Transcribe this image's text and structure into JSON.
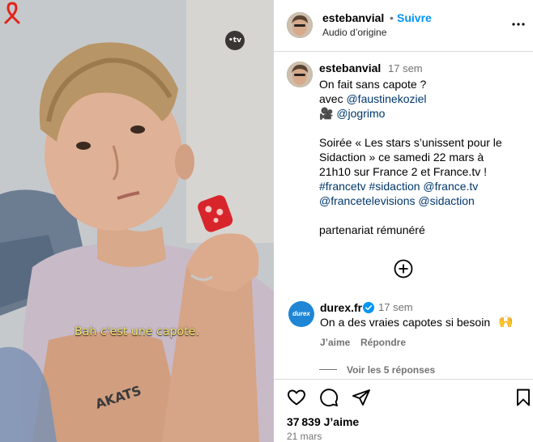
{
  "media": {
    "subtitle": "Bah c'est une capote.",
    "channel_badge": "•tv",
    "arm_tattoo": "AKATS"
  },
  "header": {
    "username": "estebanvial",
    "separator": "•",
    "follow_label": "Suivre",
    "audio_label": "Audio d’origine"
  },
  "caption": {
    "username": "estebanvial",
    "time": "17 sem",
    "line1": "On fait sans capote ?",
    "line2_prefix": "avec ",
    "mention1": "@faustinekoziel",
    "camera_emoji": "🎥",
    "mention2": "@jogrimo",
    "line4": "Soirée « Les stars s’unissent pour le",
    "line5": "Sidaction » ce samedi 22 mars à",
    "line6": "21h10 sur France 2 et France.tv !",
    "tags1": "#francetv #sidaction @france.tv",
    "tags2": "@francetelevisions @sidaction",
    "partnership": "partenariat rémunéré"
  },
  "comment": {
    "avatar_text": "durex",
    "username": "durex.fr",
    "time": "17 sem",
    "text": "On a des vraies capotes si besoin",
    "emoji": "🙌",
    "like_label": "J’aime",
    "reply_label": "Répondre",
    "view_replies": "Voir les 5 réponses"
  },
  "footer": {
    "likes": "37 839 J’aime",
    "date": "21 mars"
  },
  "icons": {
    "more": "more-options-icon",
    "add": "add-comment-icon",
    "like": "heart-icon",
    "comment": "comment-icon",
    "share": "share-icon",
    "save": "bookmark-icon",
    "verified": "verified-badge-icon"
  },
  "colors": {
    "link": "#0095f6",
    "mention": "#00376b",
    "muted": "#737373",
    "subtitle": "#f5e36a",
    "durex_blue": "#1f86d6",
    "verified": "#0095f6"
  }
}
